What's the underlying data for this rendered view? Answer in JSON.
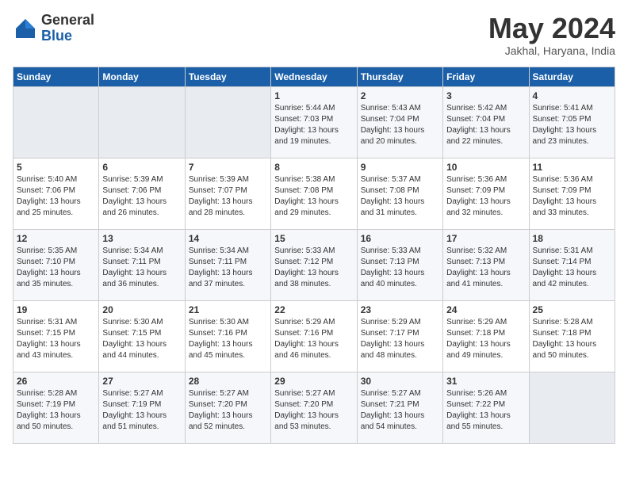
{
  "header": {
    "logo_general": "General",
    "logo_blue": "Blue",
    "title": "May 2024",
    "subtitle": "Jakhal, Haryana, India"
  },
  "days_of_week": [
    "Sunday",
    "Monday",
    "Tuesday",
    "Wednesday",
    "Thursday",
    "Friday",
    "Saturday"
  ],
  "weeks": [
    [
      {
        "day": "",
        "info": ""
      },
      {
        "day": "",
        "info": ""
      },
      {
        "day": "",
        "info": ""
      },
      {
        "day": "1",
        "info": "Sunrise: 5:44 AM\nSunset: 7:03 PM\nDaylight: 13 hours and 19 minutes."
      },
      {
        "day": "2",
        "info": "Sunrise: 5:43 AM\nSunset: 7:04 PM\nDaylight: 13 hours and 20 minutes."
      },
      {
        "day": "3",
        "info": "Sunrise: 5:42 AM\nSunset: 7:04 PM\nDaylight: 13 hours and 22 minutes."
      },
      {
        "day": "4",
        "info": "Sunrise: 5:41 AM\nSunset: 7:05 PM\nDaylight: 13 hours and 23 minutes."
      }
    ],
    [
      {
        "day": "5",
        "info": "Sunrise: 5:40 AM\nSunset: 7:06 PM\nDaylight: 13 hours and 25 minutes."
      },
      {
        "day": "6",
        "info": "Sunrise: 5:39 AM\nSunset: 7:06 PM\nDaylight: 13 hours and 26 minutes."
      },
      {
        "day": "7",
        "info": "Sunrise: 5:39 AM\nSunset: 7:07 PM\nDaylight: 13 hours and 28 minutes."
      },
      {
        "day": "8",
        "info": "Sunrise: 5:38 AM\nSunset: 7:08 PM\nDaylight: 13 hours and 29 minutes."
      },
      {
        "day": "9",
        "info": "Sunrise: 5:37 AM\nSunset: 7:08 PM\nDaylight: 13 hours and 31 minutes."
      },
      {
        "day": "10",
        "info": "Sunrise: 5:36 AM\nSunset: 7:09 PM\nDaylight: 13 hours and 32 minutes."
      },
      {
        "day": "11",
        "info": "Sunrise: 5:36 AM\nSunset: 7:09 PM\nDaylight: 13 hours and 33 minutes."
      }
    ],
    [
      {
        "day": "12",
        "info": "Sunrise: 5:35 AM\nSunset: 7:10 PM\nDaylight: 13 hours and 35 minutes."
      },
      {
        "day": "13",
        "info": "Sunrise: 5:34 AM\nSunset: 7:11 PM\nDaylight: 13 hours and 36 minutes."
      },
      {
        "day": "14",
        "info": "Sunrise: 5:34 AM\nSunset: 7:11 PM\nDaylight: 13 hours and 37 minutes."
      },
      {
        "day": "15",
        "info": "Sunrise: 5:33 AM\nSunset: 7:12 PM\nDaylight: 13 hours and 38 minutes."
      },
      {
        "day": "16",
        "info": "Sunrise: 5:33 AM\nSunset: 7:13 PM\nDaylight: 13 hours and 40 minutes."
      },
      {
        "day": "17",
        "info": "Sunrise: 5:32 AM\nSunset: 7:13 PM\nDaylight: 13 hours and 41 minutes."
      },
      {
        "day": "18",
        "info": "Sunrise: 5:31 AM\nSunset: 7:14 PM\nDaylight: 13 hours and 42 minutes."
      }
    ],
    [
      {
        "day": "19",
        "info": "Sunrise: 5:31 AM\nSunset: 7:15 PM\nDaylight: 13 hours and 43 minutes."
      },
      {
        "day": "20",
        "info": "Sunrise: 5:30 AM\nSunset: 7:15 PM\nDaylight: 13 hours and 44 minutes."
      },
      {
        "day": "21",
        "info": "Sunrise: 5:30 AM\nSunset: 7:16 PM\nDaylight: 13 hours and 45 minutes."
      },
      {
        "day": "22",
        "info": "Sunrise: 5:29 AM\nSunset: 7:16 PM\nDaylight: 13 hours and 46 minutes."
      },
      {
        "day": "23",
        "info": "Sunrise: 5:29 AM\nSunset: 7:17 PM\nDaylight: 13 hours and 48 minutes."
      },
      {
        "day": "24",
        "info": "Sunrise: 5:29 AM\nSunset: 7:18 PM\nDaylight: 13 hours and 49 minutes."
      },
      {
        "day": "25",
        "info": "Sunrise: 5:28 AM\nSunset: 7:18 PM\nDaylight: 13 hours and 50 minutes."
      }
    ],
    [
      {
        "day": "26",
        "info": "Sunrise: 5:28 AM\nSunset: 7:19 PM\nDaylight: 13 hours and 50 minutes."
      },
      {
        "day": "27",
        "info": "Sunrise: 5:27 AM\nSunset: 7:19 PM\nDaylight: 13 hours and 51 minutes."
      },
      {
        "day": "28",
        "info": "Sunrise: 5:27 AM\nSunset: 7:20 PM\nDaylight: 13 hours and 52 minutes."
      },
      {
        "day": "29",
        "info": "Sunrise: 5:27 AM\nSunset: 7:20 PM\nDaylight: 13 hours and 53 minutes."
      },
      {
        "day": "30",
        "info": "Sunrise: 5:27 AM\nSunset: 7:21 PM\nDaylight: 13 hours and 54 minutes."
      },
      {
        "day": "31",
        "info": "Sunrise: 5:26 AM\nSunset: 7:22 PM\nDaylight: 13 hours and 55 minutes."
      },
      {
        "day": "",
        "info": ""
      }
    ]
  ]
}
